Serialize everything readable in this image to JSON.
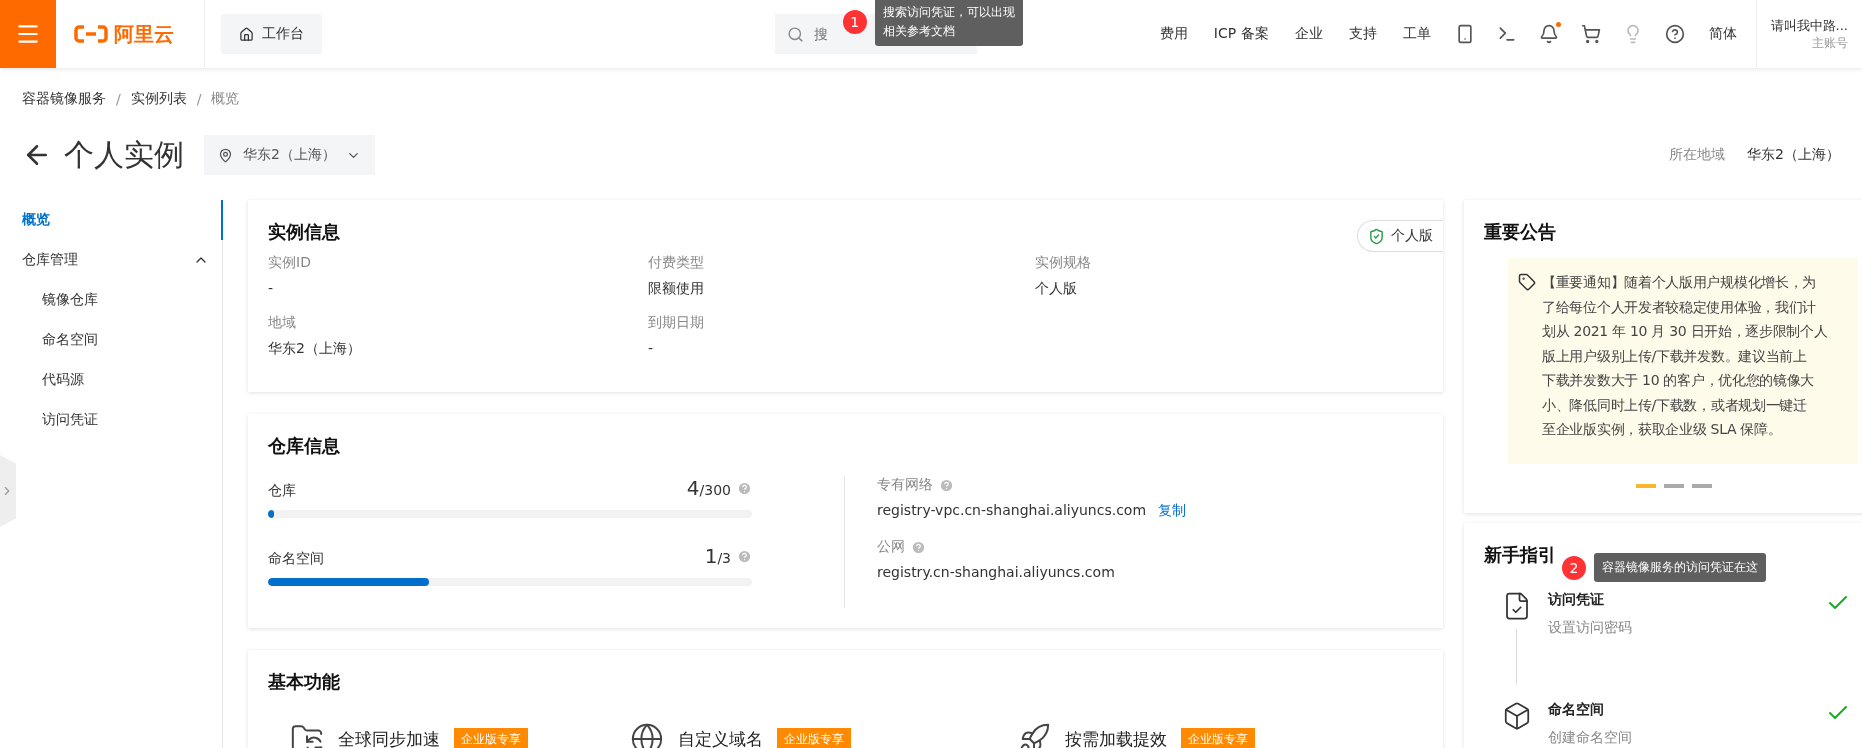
{
  "topbar": {
    "logo_text": "阿里云",
    "workbench": "工作台",
    "search": {
      "placeholder": "搜"
    },
    "nav": [
      "费用",
      "ICP 备案",
      "企业",
      "支持",
      "工单"
    ],
    "bell": {
      "unread": true
    },
    "language": "简体",
    "account": {
      "name": "请叫我中路...",
      "role": "主账号"
    }
  },
  "breadcrumb": {
    "separator": "/",
    "items": [
      "容器镜像服务",
      "实例列表",
      "概览"
    ]
  },
  "page": {
    "title": "个人实例",
    "region": "华东2（上海）",
    "region_label": "所在地域",
    "region_value": "华东2（上海）"
  },
  "sidebar": {
    "items": [
      {
        "label": "概览",
        "selected": true
      },
      {
        "label": "仓库管理",
        "selected": false,
        "expanded": true,
        "children": [
          {
            "label": "镜像仓库",
            "selected": false
          },
          {
            "label": "命名空间",
            "selected": false
          },
          {
            "label": "代码源",
            "selected": false
          },
          {
            "label": "访问凭证",
            "selected": false
          }
        ]
      }
    ]
  },
  "instance_info": {
    "title": "实例信息",
    "badge": "个人版",
    "fields": [
      {
        "label": "实例ID",
        "value": "-"
      },
      {
        "label": "付费类型",
        "value": "限额使用"
      },
      {
        "label": "实例规格",
        "value": "个人版"
      },
      {
        "label": "地域",
        "value": "华东2（上海）"
      },
      {
        "label": "到期日期",
        "value": "-"
      }
    ]
  },
  "repo_info": {
    "title": "仓库信息",
    "quotas": [
      {
        "label": "仓库",
        "used": "4",
        "total": "/300",
        "level": 0.013
      },
      {
        "label": "命名空间",
        "used": "1",
        "total": "/3",
        "level": 0.333
      }
    ],
    "endpoints": [
      {
        "label": "专有网络",
        "value": "registry-vpc.cn-shanghai.aliyuncs.com",
        "action": "复制"
      },
      {
        "label": "公网",
        "value": "registry.cn-shanghai.aliyuncs.com"
      }
    ]
  },
  "basic_features": {
    "title": "基本功能",
    "items": [
      {
        "label": "全球同步加速",
        "tag": "企业版专享",
        "kind": "sync"
      },
      {
        "label": "自定义域名",
        "tag": "企业版专享",
        "kind": "globe"
      },
      {
        "label": "按需加载提效",
        "tag": "企业版专享",
        "kind": "rocket"
      }
    ]
  },
  "announcement": {
    "title": "重要公告",
    "lines": [
      "【重要通知】随着个人版用户规模化增长，为",
      "了给每位个人开发者较稳定使用体验，我们计",
      "划从 2021 年 10 月 30 日开始，逐步限制个人",
      "版上用户级别上传/下载并发数。建议当前上",
      "下载并发数大于 10 的客户，优化您的镜像大",
      "小、降低同时上传/下载数，或者规划一键迁",
      "至企业版实例，获取企业级 SLA 保障。"
    ],
    "pages": [
      {
        "selected": true
      },
      {
        "selected": false
      },
      {
        "selected": false
      }
    ]
  },
  "guide": {
    "title": "新手指引",
    "steps": [
      {
        "title": "访问凭证",
        "subtitle": "设置访问密码",
        "done": true,
        "kind": "credential"
      },
      {
        "title": "命名空间",
        "subtitle": "创建命名空间",
        "done": true,
        "kind": "namespace"
      }
    ]
  },
  "callouts": [
    {
      "number": "1",
      "lines": [
        "搜索访问凭证，可以出现",
        "相关参考文档"
      ]
    },
    {
      "number": "2",
      "lines": [
        "容器镜像服务的访问凭证在这"
      ]
    }
  ]
}
